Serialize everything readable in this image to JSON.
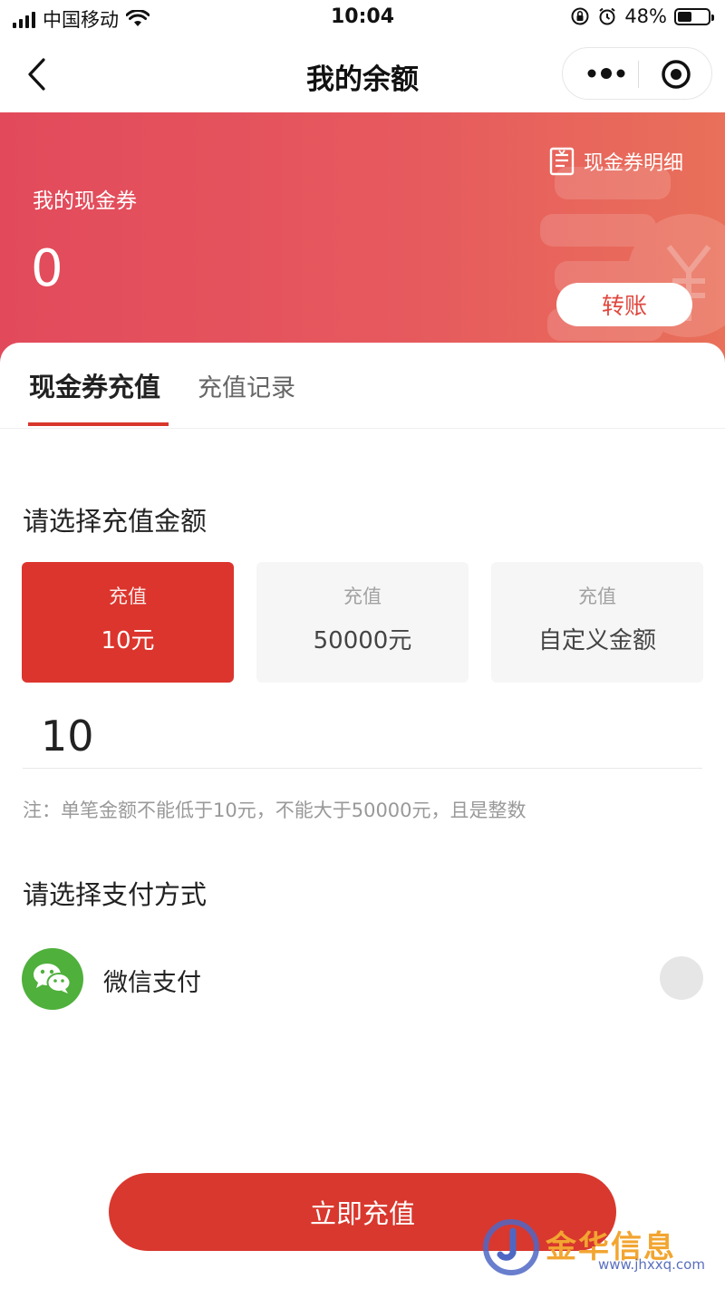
{
  "status_bar": {
    "carrier": "中国移动",
    "time": "10:04",
    "battery": "48%",
    "battery_level": 0.48
  },
  "nav": {
    "title": "我的余额"
  },
  "banner": {
    "label": "我的现金券",
    "value": "0",
    "detail_link": "现金券明细",
    "transfer_button": "转账"
  },
  "tabs": [
    {
      "label": "现金券充值",
      "active": true
    },
    {
      "label": "充值记录",
      "active": false
    }
  ],
  "recharge": {
    "section_title": "请选择充值金额",
    "options": [
      {
        "top": "充值",
        "amount": "10元",
        "selected": true
      },
      {
        "top": "充值",
        "amount": "50000元",
        "selected": false
      },
      {
        "top": "充值",
        "amount": "自定义金额",
        "selected": false
      }
    ],
    "input_value": "10",
    "note": "注：单笔金额不能低于10元，不能大于50000元，且是整数"
  },
  "payment": {
    "section_title": "请选择支付方式",
    "method": "微信支付",
    "icon": "wechat-icon"
  },
  "submit_label": "立即充值",
  "watermark": {
    "text": "金华信息",
    "url": "www.jhxxq.com"
  },
  "colors": {
    "accent": "#d9382e",
    "banner_start": "#e24a5b",
    "banner_end": "#e9705a",
    "wechat_green": "#4fb03c"
  }
}
